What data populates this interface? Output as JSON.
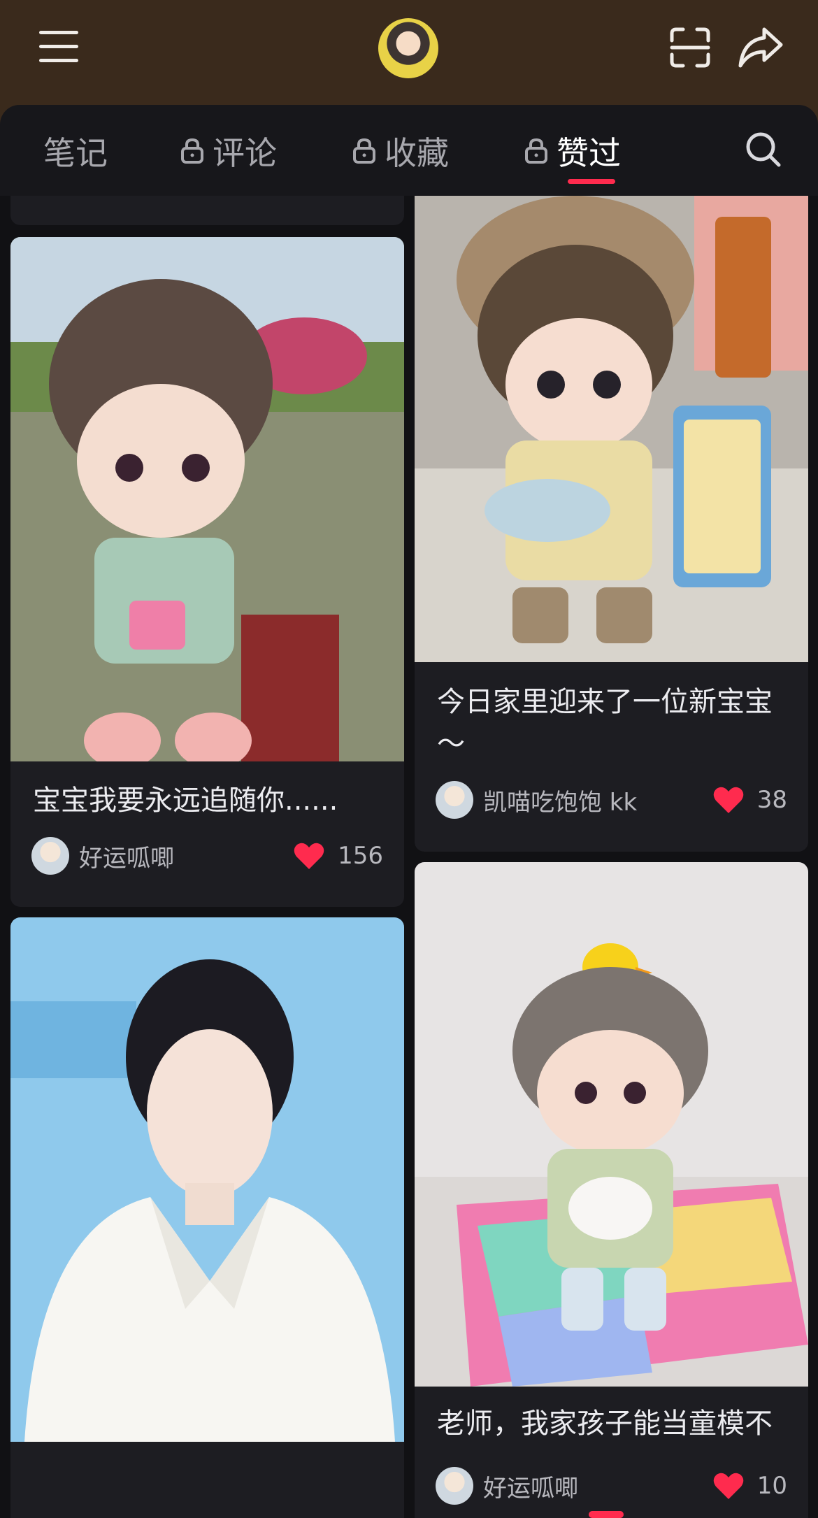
{
  "tabs": [
    {
      "label": "笔记",
      "locked": false
    },
    {
      "label": "评论",
      "locked": true
    },
    {
      "label": "收藏",
      "locked": true
    },
    {
      "label": "赞过",
      "locked": true,
      "active": true
    }
  ],
  "cards": [
    {
      "title": "宝宝我要永远追随你......",
      "author": "好运呱唧",
      "likes": "156",
      "image": "plush doll with brown hair by a lake"
    },
    {
      "title": "",
      "author": "",
      "likes": "",
      "image": "young man in white suit against blue backdrop"
    },
    {
      "title": "今日家里迎来了一位新宝宝～",
      "author": "凯喵吃饱饱 kk",
      "likes": "38",
      "image": "plush doll wearing a bunny hat on a desk"
    },
    {
      "title": "老师，我家孩子能当童模不",
      "author": "好运呱唧",
      "likes": "10",
      "image": "plush doll with a rubber duck on its head on a foam mat"
    }
  ],
  "colors": {
    "accent": "#ff2b4e",
    "header_bg": "#3a2a1c",
    "card_bg": "#1d1d22",
    "page_bg": "#111114"
  },
  "icons": [
    "menu-icon",
    "scan-icon",
    "share-icon",
    "search-icon",
    "lock-icon",
    "heart-icon"
  ]
}
